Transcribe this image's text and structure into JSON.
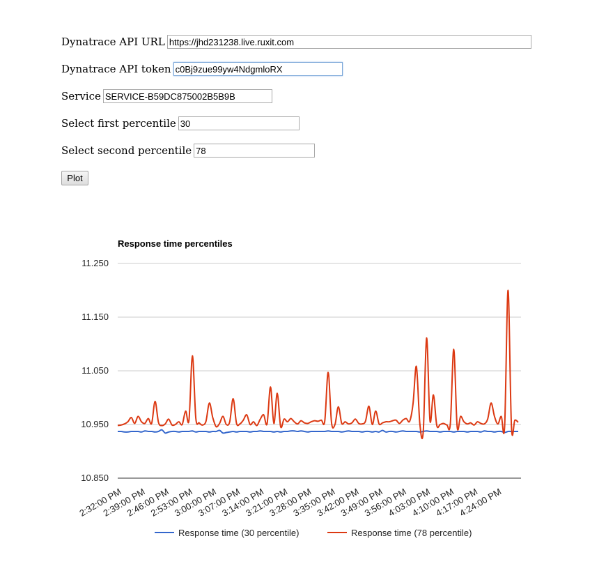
{
  "form": {
    "api_url_label": "Dynatrace API URL",
    "api_url_value": "https://jhd231238.live.ruxit.com",
    "api_token_label": "Dynatrace API token",
    "api_token_value": "c0Bj9zue99yw4NdgmloRX",
    "service_label": "Service",
    "service_value": "SERVICE-B59DC875002B5B9B",
    "first_percentile_label": "Select first percentile",
    "first_percentile_value": "30",
    "second_percentile_label": "Select second percentile",
    "second_percentile_value": "78",
    "plot_button_label": "Plot"
  },
  "chart_data": {
    "type": "line",
    "title": "Response time percentiles",
    "xlabel": "",
    "ylabel": "",
    "ylim": [
      10.85,
      11.25
    ],
    "y_ticks": [
      "10.850",
      "10.950",
      "11.050",
      "11.150",
      "11.250"
    ],
    "x_tick_labels": [
      "2:32:00 PM",
      "2:39:00 PM",
      "2:46:00 PM",
      "2:53:00 PM",
      "3:00:00 PM",
      "3:07:00 PM",
      "3:14:00 PM",
      "3:21:00 PM",
      "3:28:00 PM",
      "3:35:00 PM",
      "3:42:00 PM",
      "3:49:00 PM",
      "3:56:00 PM",
      "4:03:00 PM",
      "4:10:00 PM",
      "4:17:00 PM",
      "4:24:00 PM"
    ],
    "grid": true,
    "legend_position": "bottom",
    "x": [
      "2:32:00 PM",
      "2:33:00 PM",
      "2:34:00 PM",
      "2:35:00 PM",
      "2:36:00 PM",
      "2:37:00 PM",
      "2:38:00 PM",
      "2:39:00 PM",
      "2:40:00 PM",
      "2:41:00 PM",
      "2:42:00 PM",
      "2:43:00 PM",
      "2:44:00 PM",
      "2:45:00 PM",
      "2:46:00 PM",
      "2:47:00 PM",
      "2:48:00 PM",
      "2:49:00 PM",
      "2:50:00 PM",
      "2:51:00 PM",
      "2:52:00 PM",
      "2:53:00 PM",
      "2:54:00 PM",
      "2:55:00 PM",
      "2:56:00 PM",
      "2:57:00 PM",
      "2:58:00 PM",
      "2:59:00 PM",
      "3:00:00 PM",
      "3:01:00 PM",
      "3:02:00 PM",
      "3:03:00 PM",
      "3:04:00 PM",
      "3:05:00 PM",
      "3:06:00 PM",
      "3:07:00 PM",
      "3:08:00 PM",
      "3:09:00 PM",
      "3:10:00 PM",
      "3:11:00 PM",
      "3:12:00 PM",
      "3:13:00 PM",
      "3:14:00 PM",
      "3:15:00 PM",
      "3:16:00 PM",
      "3:17:00 PM",
      "3:18:00 PM",
      "3:19:00 PM",
      "3:20:00 PM",
      "3:21:00 PM",
      "3:22:00 PM",
      "3:23:00 PM",
      "3:24:00 PM",
      "3:25:00 PM",
      "3:26:00 PM",
      "3:27:00 PM",
      "3:28:00 PM",
      "3:29:00 PM",
      "3:30:00 PM",
      "3:31:00 PM",
      "3:32:00 PM",
      "3:33:00 PM",
      "3:34:00 PM",
      "3:35:00 PM",
      "3:36:00 PM",
      "3:37:00 PM",
      "3:38:00 PM",
      "3:39:00 PM",
      "3:40:00 PM",
      "3:41:00 PM",
      "3:42:00 PM",
      "3:43:00 PM",
      "3:44:00 PM",
      "3:45:00 PM",
      "3:46:00 PM",
      "3:47:00 PM",
      "3:48:00 PM",
      "3:49:00 PM",
      "3:50:00 PM",
      "3:51:00 PM",
      "3:52:00 PM",
      "3:53:00 PM",
      "3:54:00 PM",
      "3:55:00 PM",
      "3:56:00 PM",
      "3:57:00 PM",
      "3:58:00 PM",
      "3:59:00 PM",
      "4:00:00 PM",
      "4:01:00 PM",
      "4:02:00 PM",
      "4:03:00 PM",
      "4:04:00 PM",
      "4:05:00 PM",
      "4:06:00 PM",
      "4:07:00 PM",
      "4:08:00 PM",
      "4:09:00 PM",
      "4:10:00 PM",
      "4:11:00 PM",
      "4:12:00 PM",
      "4:13:00 PM",
      "4:14:00 PM",
      "4:15:00 PM",
      "4:16:00 PM",
      "4:17:00 PM",
      "4:18:00 PM",
      "4:19:00 PM",
      "4:20:00 PM",
      "4:21:00 PM",
      "4:22:00 PM",
      "4:23:00 PM",
      "4:24:00 PM",
      "4:25:00 PM",
      "4:26:00 PM",
      "4:27:00 PM",
      "4:28:00 PM",
      "4:29:00 PM",
      "4:30:00 PM"
    ],
    "series": [
      {
        "name": "Response time (30 percentile)",
        "color": "#3366cc",
        "values": [
          10.937,
          10.937,
          10.936,
          10.936,
          10.937,
          10.937,
          10.937,
          10.936,
          10.938,
          10.937,
          10.937,
          10.936,
          10.937,
          10.94,
          10.934,
          10.936,
          10.937,
          10.937,
          10.936,
          10.937,
          10.937,
          10.937,
          10.938,
          10.936,
          10.937,
          10.937,
          10.937,
          10.936,
          10.937,
          10.937,
          10.939,
          10.934,
          10.935,
          10.936,
          10.937,
          10.936,
          10.937,
          10.937,
          10.937,
          10.936,
          10.937,
          10.937,
          10.938,
          10.937,
          10.937,
          10.937,
          10.936,
          10.937,
          10.936,
          10.937,
          10.937,
          10.938,
          10.938,
          10.937,
          10.938,
          10.937,
          10.936,
          10.937,
          10.937,
          10.937,
          10.937,
          10.937,
          10.938,
          10.937,
          10.937,
          10.937,
          10.936,
          10.937,
          10.938,
          10.937,
          10.937,
          10.937,
          10.936,
          10.937,
          10.937,
          10.936,
          10.937,
          10.936,
          10.939,
          10.936,
          10.937,
          10.937,
          10.936,
          10.937,
          10.938,
          10.937,
          10.937,
          10.937,
          10.937,
          10.936,
          10.937,
          10.938,
          10.937,
          10.937,
          10.937,
          10.936,
          10.937,
          10.937,
          10.937,
          10.936,
          10.937,
          10.937,
          10.937,
          10.936,
          10.937,
          10.937,
          10.937,
          10.936,
          10.938,
          10.937,
          10.937,
          10.936,
          10.937,
          10.937,
          10.935,
          10.937,
          10.937,
          10.937,
          10.937
        ]
      },
      {
        "name": "Response time (78 percentile)",
        "color": "#dc3912",
        "values": [
          10.948,
          10.949,
          10.951,
          10.955,
          10.963,
          10.952,
          10.965,
          10.955,
          10.952,
          10.961,
          10.952,
          10.993,
          10.954,
          10.948,
          10.951,
          10.96,
          10.949,
          10.95,
          10.955,
          10.95,
          10.975,
          10.958,
          11.078,
          10.962,
          10.953,
          10.949,
          10.956,
          10.99,
          10.963,
          10.946,
          10.952,
          10.965,
          10.95,
          10.955,
          10.998,
          10.952,
          10.951,
          10.958,
          10.968,
          10.95,
          10.955,
          10.948,
          10.96,
          10.968,
          10.951,
          11.02,
          10.952,
          11.008,
          10.946,
          10.96,
          10.955,
          10.961,
          10.955,
          10.951,
          10.957,
          10.953,
          10.952,
          10.955,
          10.957,
          10.956,
          10.958,
          10.956,
          11.047,
          10.953,
          10.95,
          10.983,
          10.952,
          10.955,
          10.951,
          10.953,
          10.96,
          10.952,
          10.951,
          10.956,
          10.984,
          10.95,
          10.975,
          10.951,
          10.953,
          10.955,
          10.955,
          10.957,
          10.958,
          10.952,
          10.958,
          10.961,
          10.956,
          10.988,
          11.058,
          10.952,
          10.936,
          11.111,
          10.957,
          11.005,
          10.948,
          10.95,
          10.952,
          10.949,
          10.951,
          11.09,
          10.946,
          10.965,
          10.955,
          10.951,
          10.953,
          10.949,
          10.955,
          10.952,
          10.951,
          10.96,
          10.99,
          10.965,
          10.951,
          10.965,
          10.947,
          11.2,
          10.945,
          10.958,
          10.954
        ]
      }
    ]
  }
}
